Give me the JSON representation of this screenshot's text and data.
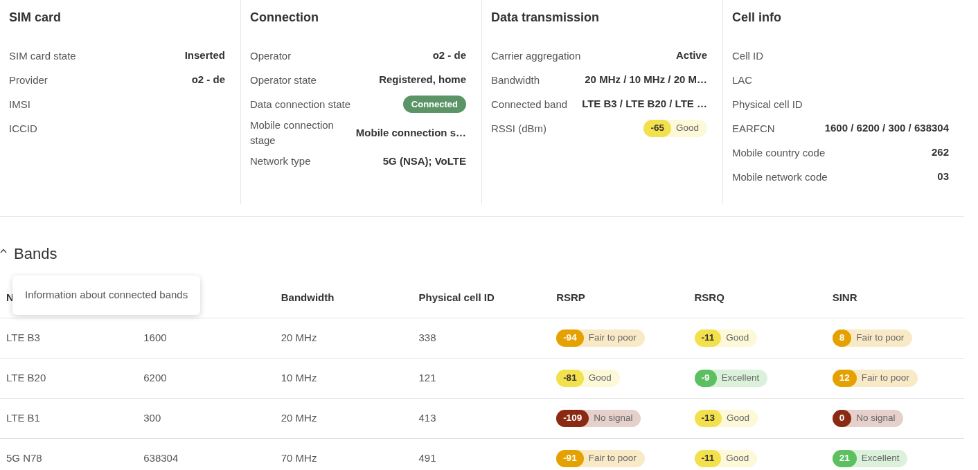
{
  "panels": [
    {
      "title": "SIM card",
      "rows": [
        {
          "label": "SIM card state",
          "value": "Inserted"
        },
        {
          "label": "Provider",
          "value": "o2 - de"
        },
        {
          "label": "IMSI"
        },
        {
          "label": "ICCID"
        }
      ]
    },
    {
      "title": "Connection",
      "rows": [
        {
          "label": "Operator",
          "value": "o2 - de"
        },
        {
          "label": "Operator state",
          "value": "Registered, home"
        },
        {
          "label": "Data connection state",
          "kind": "status",
          "value": "Connected"
        },
        {
          "label": "Mobile connection stage",
          "value": "Mobile connection s…"
        },
        {
          "label": "Network type",
          "value": "5G (NSA); VoLTE"
        }
      ]
    },
    {
      "title": "Data transmission",
      "rows": [
        {
          "label": "Carrier aggregation",
          "value": "Active"
        },
        {
          "label": "Bandwidth",
          "value": "20 MHz / 10 MHz / 20 M…"
        },
        {
          "label": "Connected band",
          "value": "LTE B3 / LTE B20 / LTE …"
        },
        {
          "label": "RSSI (dBm)",
          "kind": "signal",
          "number": "-65",
          "quality": "Good",
          "color": "#f2e14c"
        }
      ]
    },
    {
      "title": "Cell info",
      "rows": [
        {
          "label": "Cell ID"
        },
        {
          "label": "LAC"
        },
        {
          "label": "Physical cell ID"
        },
        {
          "label": "EARFCN",
          "value": "1600 / 6200 / 300 / 638304"
        },
        {
          "label": "Mobile country code",
          "value": "262"
        },
        {
          "label": "Mobile network code",
          "value": "03"
        }
      ]
    }
  ],
  "bands": {
    "title": "Bands",
    "expanded": true,
    "tooltip": "Information about connected bands",
    "columns": [
      {
        "label": "N"
      },
      {},
      {
        "label": "Bandwidth"
      },
      {
        "label": "Physical cell ID"
      },
      {
        "label": "RSRP"
      },
      {
        "label": "RSRQ"
      },
      {
        "label": "SINR"
      }
    ],
    "rows": [
      {
        "cells": [
          "LTE B3",
          "1600",
          "20 MHz",
          "338"
        ],
        "signals": [
          {
            "number": "-94",
            "quality": "Fair to poor",
            "color": "#e5a100"
          },
          {
            "number": "-11",
            "quality": "Good",
            "color": "#f2e14c"
          },
          {
            "number": "8",
            "quality": "Fair to poor",
            "color": "#e5a100"
          }
        ]
      },
      {
        "cells": [
          "LTE B20",
          "6200",
          "10 MHz",
          "121"
        ],
        "signals": [
          {
            "number": "-81",
            "quality": "Good",
            "color": "#f2e14c"
          },
          {
            "number": "-9",
            "quality": "Excellent",
            "color": "#5cbf60"
          },
          {
            "number": "12",
            "quality": "Fair to poor",
            "color": "#e5a100"
          }
        ]
      },
      {
        "cells": [
          "LTE B1",
          "300",
          "20 MHz",
          "413"
        ],
        "signals": [
          {
            "number": "-109",
            "quality": "No signal",
            "color": "#8b2a12"
          },
          {
            "number": "-13",
            "quality": "Good",
            "color": "#f2e14c"
          },
          {
            "number": "0",
            "quality": "No signal",
            "color": "#8b2a12"
          }
        ]
      },
      {
        "cells": [
          "5G N78",
          "638304",
          "70 MHz",
          "491"
        ],
        "signals": [
          {
            "number": "-91",
            "quality": "Fair to poor",
            "color": "#e5a100"
          },
          {
            "number": "-11",
            "quality": "Good",
            "color": "#f2e14c"
          },
          {
            "number": "21",
            "quality": "Excellent",
            "color": "#5cbf60"
          }
        ]
      }
    ]
  }
}
